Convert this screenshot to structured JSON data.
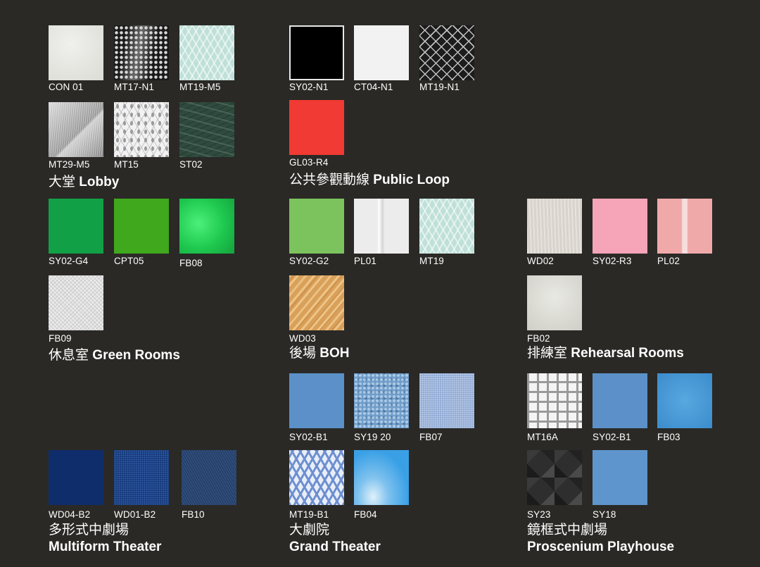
{
  "groups": {
    "lobby": {
      "zh": "大堂",
      "en": "Lobby",
      "swatches": [
        "CON 01",
        "MT17-N1",
        "MT19-M5",
        "MT29-M5",
        "MT15",
        "ST02"
      ]
    },
    "public_loop": {
      "zh": "公共參觀動線",
      "en": "Public Loop",
      "swatches": [
        "SY02-N1",
        "CT04-N1",
        "MT19-N1",
        "GL03-R4"
      ]
    },
    "green_rooms": {
      "zh": "休息室",
      "en": "Green Rooms",
      "swatches": [
        "SY02-G4",
        "CPT05",
        "FB08",
        "FB09"
      ]
    },
    "boh": {
      "zh": "後場",
      "en": "BOH",
      "swatches": [
        "SY02-G2",
        "PL01",
        "MT19",
        "WD03"
      ]
    },
    "rehearsal": {
      "zh": "排練室",
      "en": "Rehearsal Rooms",
      "swatches": [
        "WD02",
        "SY02-R3",
        "PL02",
        "FB02"
      ]
    },
    "multiform": {
      "zh": "多形式中劇場",
      "en": "Multiform Theater",
      "swatches": [
        "WD04-B2",
        "WD01-B2",
        "FB10"
      ]
    },
    "grand": {
      "zh": "大劇院",
      "en": "Grand Theater",
      "swatches": [
        "SY02-B1",
        "SY19 20",
        "FB07",
        "MT19-B1",
        "FB04"
      ]
    },
    "proscenium": {
      "zh": "鏡框式中劇場",
      "en": "Proscenium Playhouse",
      "swatches": [
        "MT16A",
        "SY02-B1",
        "FB03",
        "SY23",
        "SY18"
      ]
    }
  },
  "colors": {
    "background": "#2a2926",
    "text": "#ffffff",
    "GL03-R4": "#f03a33",
    "SY02-G4": "#12a046",
    "CPT05": "#40a81d",
    "SY02-G2": "#7cc35d",
    "SY02-R3": "#f6a5b8",
    "SY02-B1": "#5b91c8",
    "WD04-B2": "#0f2d6a"
  }
}
